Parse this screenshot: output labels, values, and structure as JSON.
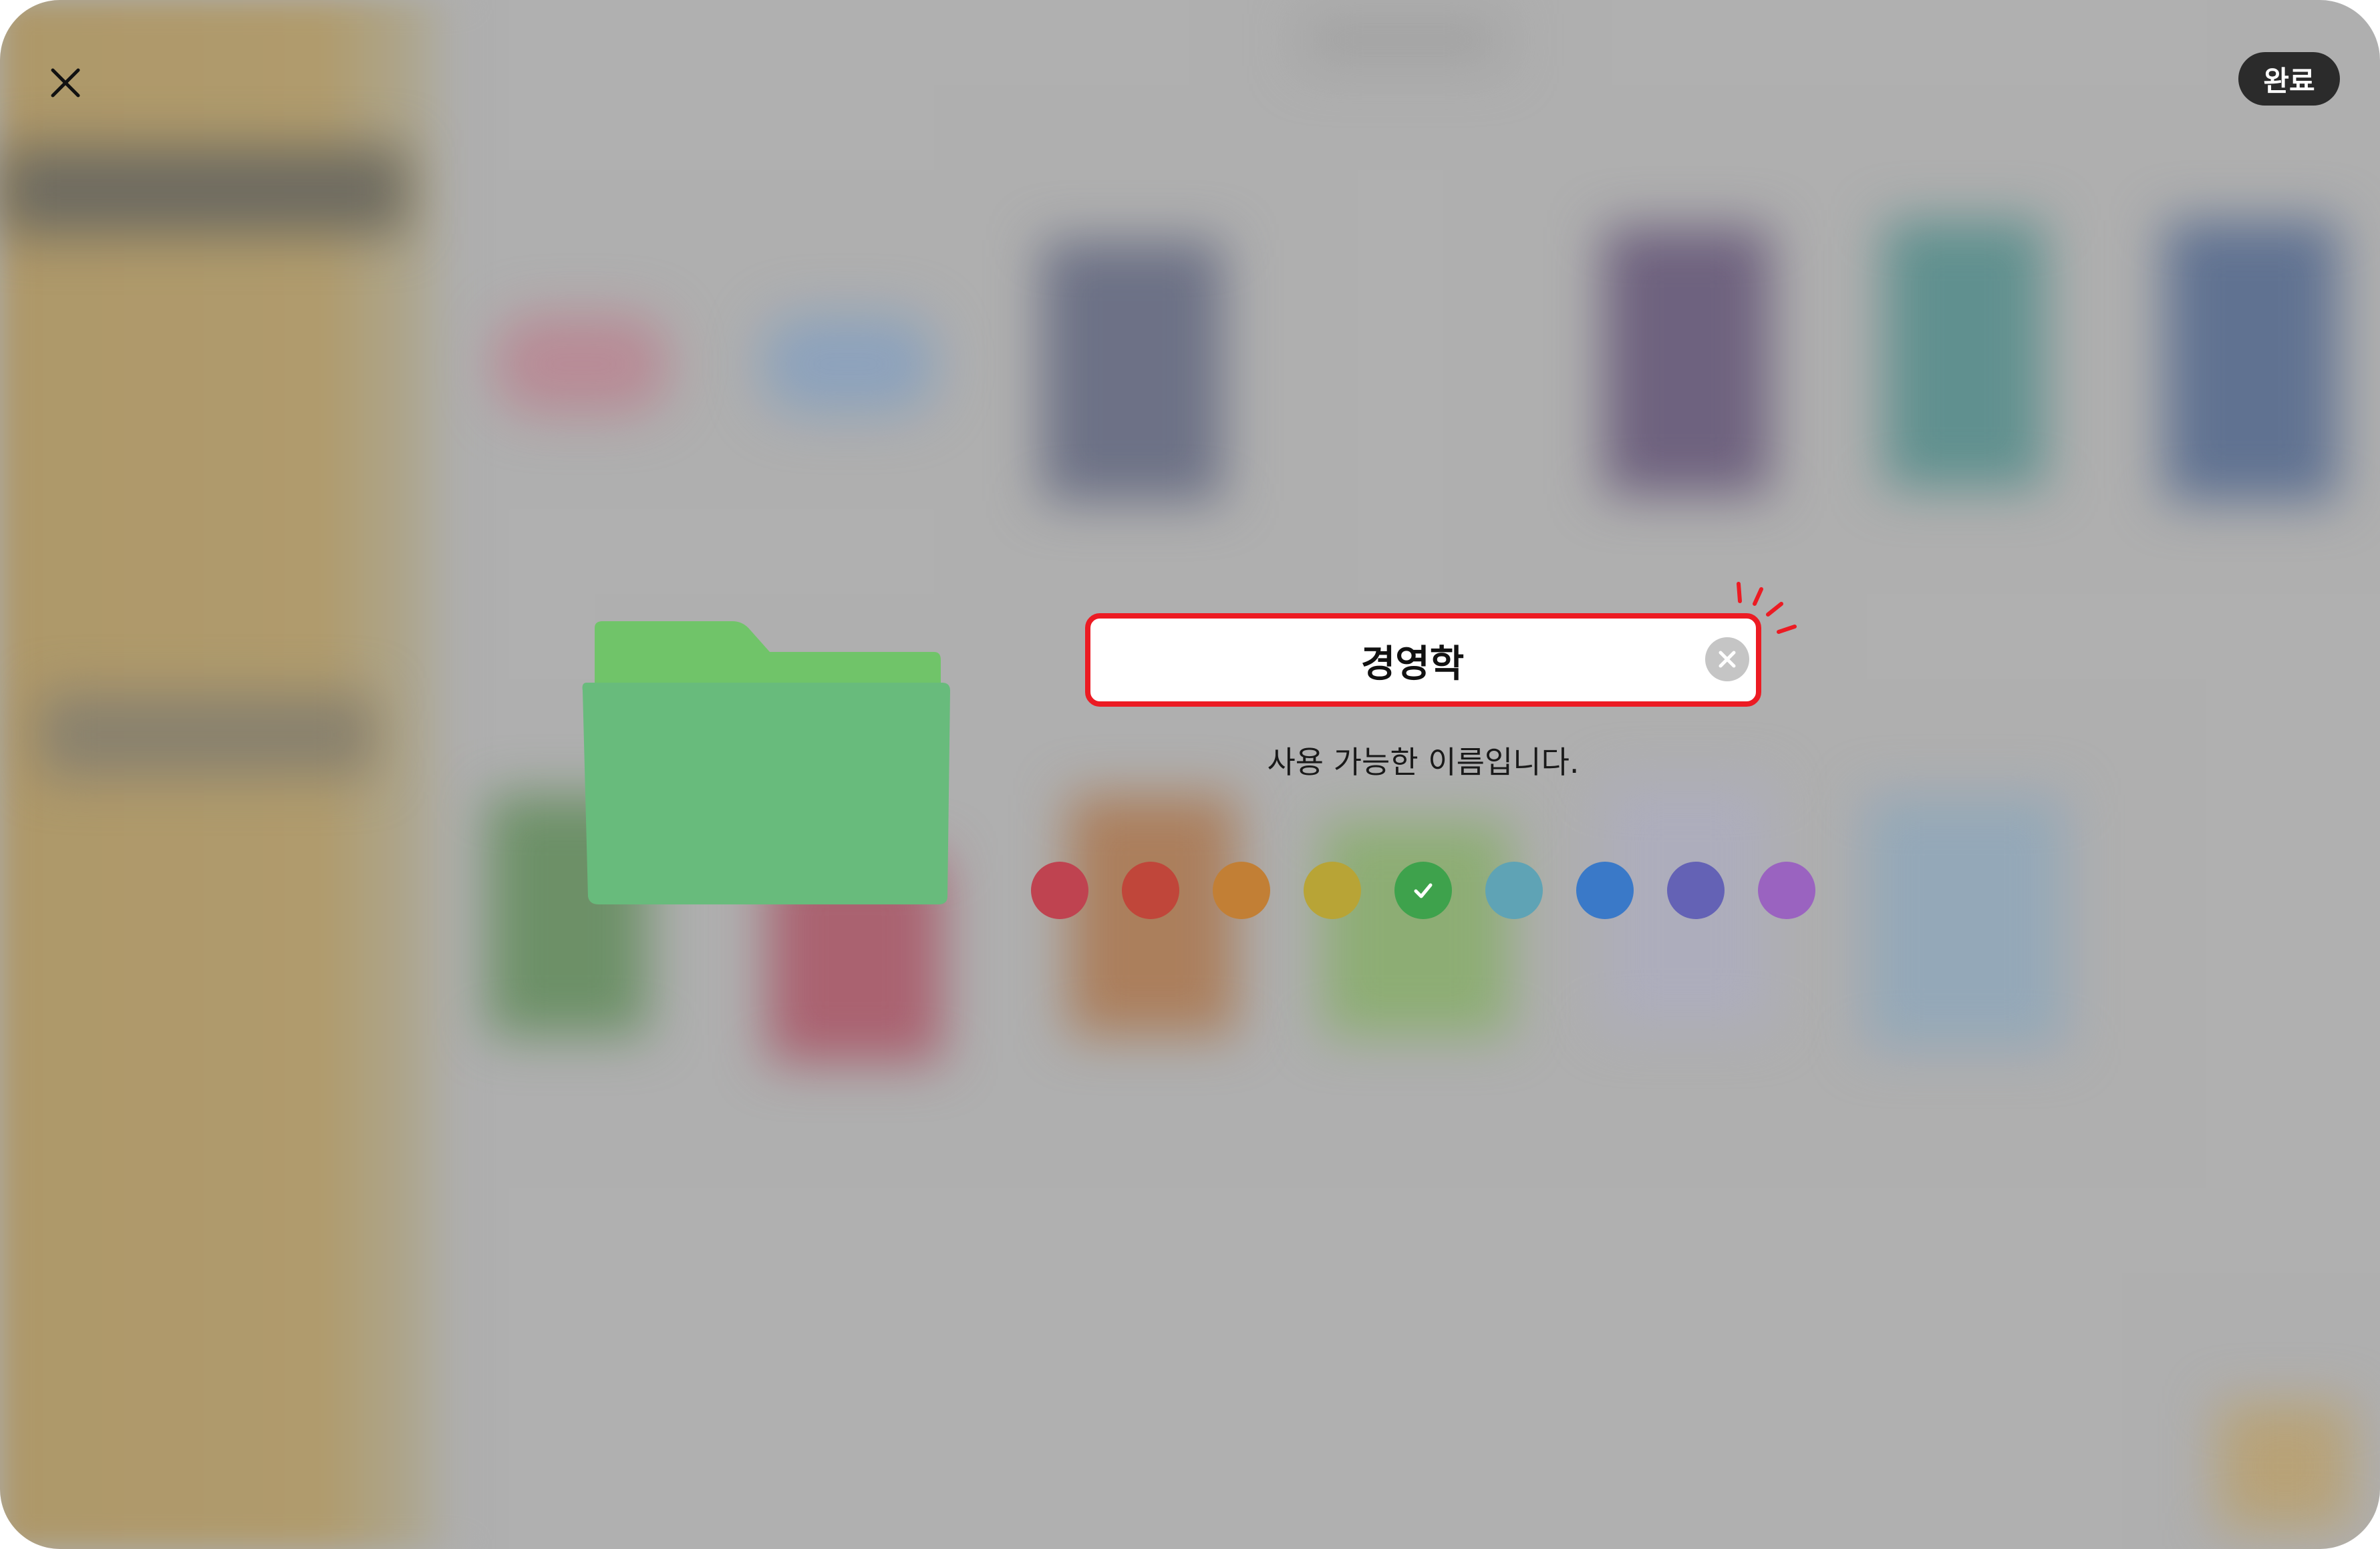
{
  "header": {
    "close_icon": "close-icon",
    "done_label": "완료"
  },
  "folder": {
    "color": "#68bb7c",
    "tab_color": "#70c469"
  },
  "name_input": {
    "value": "경영학",
    "highlight_color": "#ec1b23",
    "clear_icon": "clear-circle-icon"
  },
  "status": {
    "message": "사용 가능한 이름입니다."
  },
  "color_options": [
    {
      "name": "red",
      "color": "#bf4350",
      "selected": false
    },
    {
      "name": "vermilion",
      "color": "#c0463a",
      "selected": false
    },
    {
      "name": "orange",
      "color": "#c27f35",
      "selected": false
    },
    {
      "name": "yellow",
      "color": "#b8a436",
      "selected": false
    },
    {
      "name": "green",
      "color": "#3ea24c",
      "selected": true
    },
    {
      "name": "teal",
      "color": "#5fa3b5",
      "selected": false
    },
    {
      "name": "blue",
      "color": "#3a79c8",
      "selected": false
    },
    {
      "name": "indigo",
      "color": "#6462b5",
      "selected": false
    },
    {
      "name": "purple",
      "color": "#9a63c0",
      "selected": false
    }
  ]
}
